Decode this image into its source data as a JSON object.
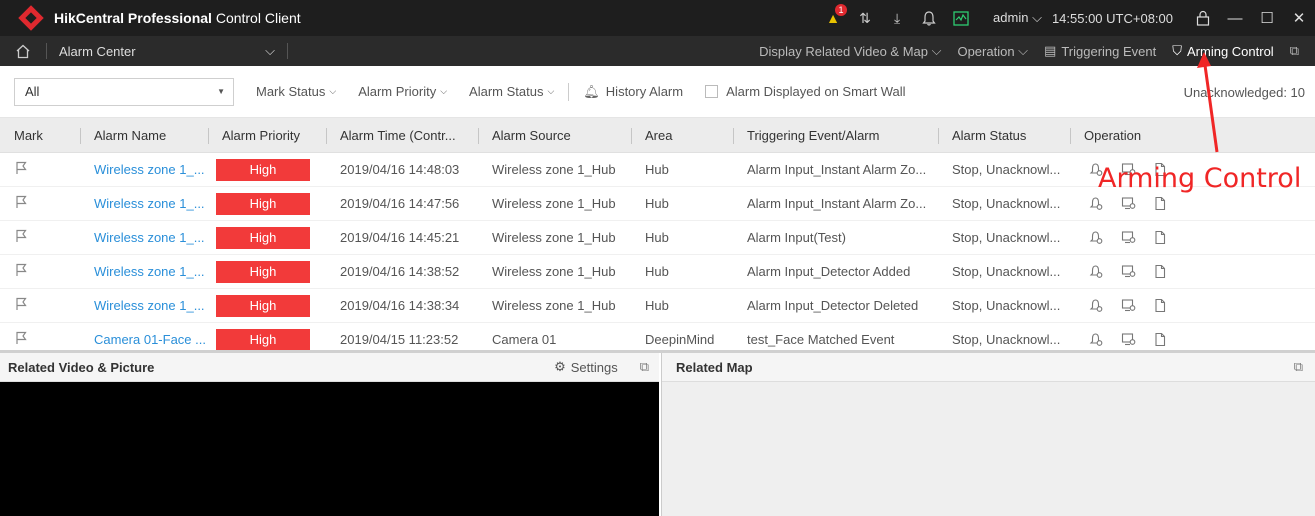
{
  "app": {
    "title_bold": "HikCentral Professional",
    "title_rest": " Control Client",
    "warning_count": "1",
    "user": "admin",
    "clock": "14:55:00 UTC+08:00"
  },
  "nav": {
    "module": "Alarm Center",
    "display_related": "Display Related Video & Map",
    "operation": "Operation",
    "triggering_event": "Triggering Event",
    "arming_control": "Arming Control"
  },
  "filters": {
    "type_value": "All",
    "mark_status": "Mark Status",
    "alarm_priority": "Alarm Priority",
    "alarm_status": "Alarm Status",
    "history_alarm": "History Alarm",
    "smart_wall": "Alarm Displayed on Smart Wall",
    "unacknowledged": "Unacknowledged: 10"
  },
  "table": {
    "headers": [
      "Mark",
      "Alarm Name",
      "Alarm Priority",
      "Alarm Time (Contr...",
      "Alarm Source",
      "Area",
      "Triggering Event/Alarm",
      "Alarm Status",
      "Operation"
    ],
    "rows": [
      {
        "name": "Wireless zone 1_...",
        "priority": "High",
        "time": "2019/04/16 14:48:03",
        "source": "Wireless zone 1_Hub",
        "area": "Hub",
        "event": "Alarm Input_Instant Alarm Zo...",
        "status": "Stop, Unacknowl..."
      },
      {
        "name": "Wireless zone 1_...",
        "priority": "High",
        "time": "2019/04/16 14:47:56",
        "source": "Wireless zone 1_Hub",
        "area": "Hub",
        "event": "Alarm Input_Instant Alarm Zo...",
        "status": "Stop, Unacknowl..."
      },
      {
        "name": "Wireless zone 1_...",
        "priority": "High",
        "time": "2019/04/16 14:45:21",
        "source": "Wireless zone 1_Hub",
        "area": "Hub",
        "event": "Alarm Input(Test)",
        "status": "Stop, Unacknowl..."
      },
      {
        "name": "Wireless zone 1_...",
        "priority": "High",
        "time": "2019/04/16 14:38:52",
        "source": "Wireless zone 1_Hub",
        "area": "Hub",
        "event": "Alarm Input_Detector Added",
        "status": "Stop, Unacknowl..."
      },
      {
        "name": "Wireless zone 1_...",
        "priority": "High",
        "time": "2019/04/16 14:38:34",
        "source": "Wireless zone 1_Hub",
        "area": "Hub",
        "event": "Alarm Input_Detector Deleted",
        "status": "Stop, Unacknowl..."
      },
      {
        "name": "Camera 01-Face ...",
        "priority": "High",
        "time": "2019/04/15 11:23:52",
        "source": "Camera 01",
        "area": "DeepinMind",
        "event": "test_Face Matched Event",
        "status": "Stop, Unacknowl..."
      }
    ]
  },
  "panels": {
    "video_title": "Related Video & Picture",
    "settings": "Settings",
    "map_title": "Related Map"
  },
  "annotation": {
    "text": "Arming Control",
    "color": "#f02626"
  },
  "colors": {
    "priority_high": "#f23a3a",
    "link": "#2a8fd9",
    "titlebar": "#1e1e1e"
  }
}
